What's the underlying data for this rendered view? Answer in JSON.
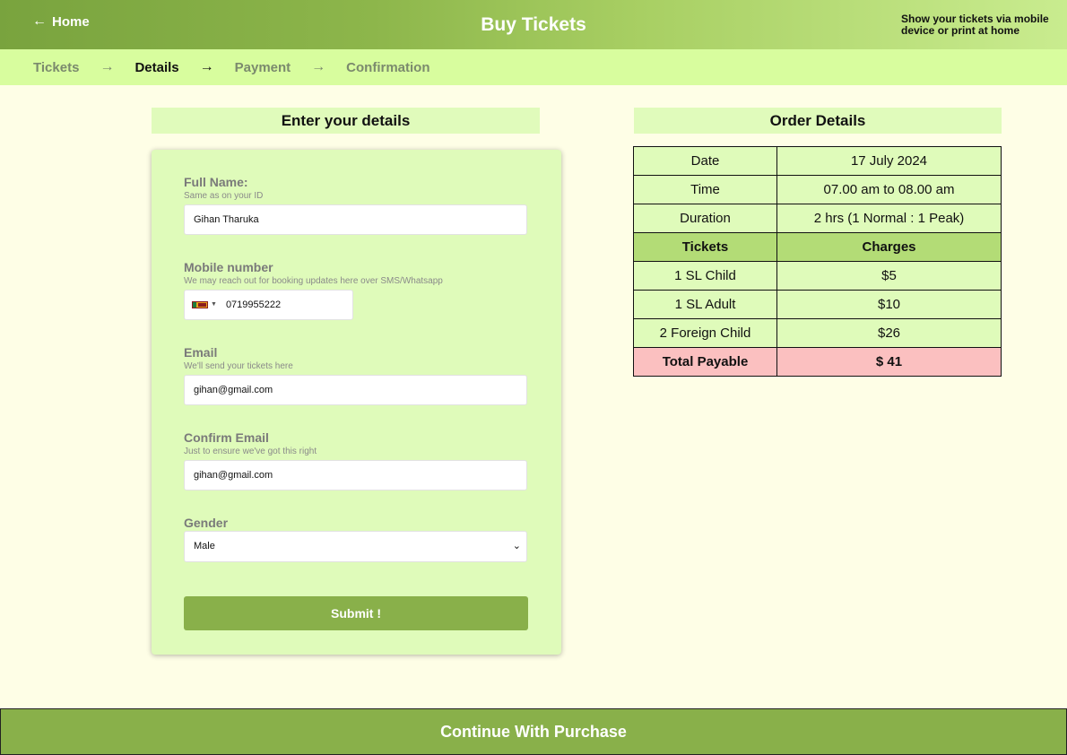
{
  "header": {
    "home_label": "Home",
    "home_icon": "arrow-left-icon",
    "title": "Buy Tickets",
    "note": "Show your tickets via mobile device or print at home",
    "gradient_colors": [
      "#79a33e",
      "#c9ec8f"
    ]
  },
  "steps": [
    {
      "label": "Tickets",
      "active": false
    },
    {
      "label": "Details",
      "active": true
    },
    {
      "label": "Payment",
      "active": false
    },
    {
      "label": "Confirmation",
      "active": false
    }
  ],
  "form": {
    "heading": "Enter your details",
    "full_name": {
      "label": "Full Name:",
      "hint": "Same as on your ID",
      "value": "Gihan Tharuka"
    },
    "mobile": {
      "label": "Mobile number",
      "hint": "We may reach out for booking updates here over SMS/Whatsapp",
      "flag_icon": "sri-lanka-flag-icon",
      "value": "0719955222"
    },
    "email": {
      "label": "Email",
      "hint": "We'll send your tickets here",
      "value": "gihan@gmail.com"
    },
    "confirm_email": {
      "label": "Confirm Email",
      "hint": "Just to ensure we've got this right",
      "value": "gihan@gmail.com"
    },
    "gender": {
      "label": "Gender",
      "selected": "Male"
    },
    "submit_label": "Submit !"
  },
  "order": {
    "heading": "Order Details",
    "info_rows": [
      {
        "label": "Date",
        "value": "17 July 2024"
      },
      {
        "label": "Time",
        "value": "07.00 am to 08.00 am"
      },
      {
        "label": "Duration",
        "value": "2 hrs (1 Normal : 1 Peak)"
      }
    ],
    "columns": [
      "Tickets",
      "Charges"
    ],
    "ticket_rows": [
      {
        "ticket": "1 SL Child",
        "charge": "$5"
      },
      {
        "ticket": "1 SL Adult",
        "charge": "$10"
      },
      {
        "ticket": "2 Foreign Child",
        "charge": "$26"
      }
    ],
    "total": {
      "label": "Total Payable",
      "value": "$ 41"
    }
  },
  "footer": {
    "continue_label": "Continue With Purchase"
  },
  "colors": {
    "accent": "#89b04a",
    "page_bg": "#fefee6",
    "card_bg": "#dffbba",
    "total_bg": "#fbc0c0",
    "steps_bg": "#d8fd9e"
  }
}
